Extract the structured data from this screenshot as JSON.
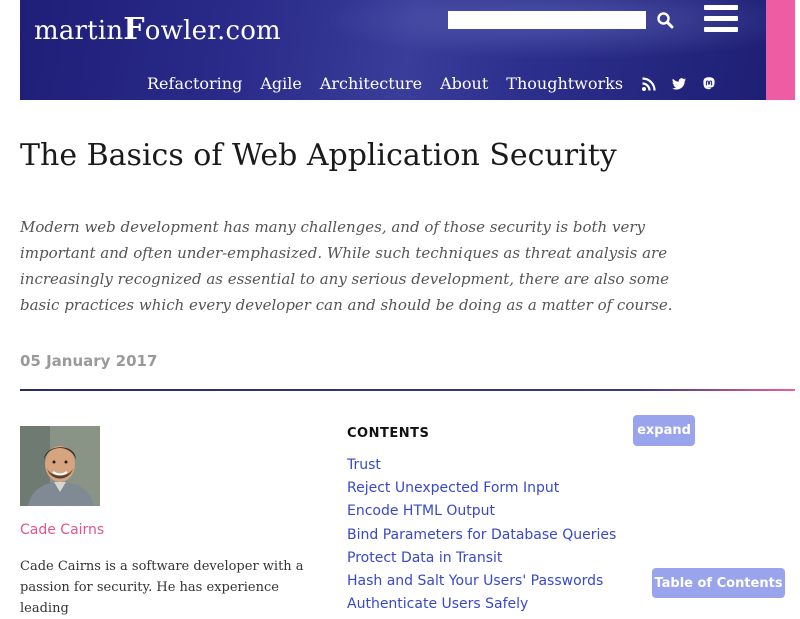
{
  "site": {
    "logo_prefix": "martin",
    "logo_initial": "F",
    "logo_suffix": "owler.com",
    "search_value": "",
    "nav": [
      "Refactoring",
      "Agile",
      "Architecture",
      "About",
      "Thoughtworks"
    ],
    "icons": [
      "search-icon",
      "menu-icon",
      "rss-icon",
      "twitter-icon",
      "mastodon-icon"
    ],
    "colors": {
      "header": "#2a2b8a",
      "accent_pink": "#ee5da3",
      "link": "#3848c8",
      "button": "#9aa4ec",
      "author": "#e2548f"
    }
  },
  "article": {
    "title": "The Basics of Web Application Security",
    "abstract": "Modern web development has many challenges, and of those security is both very important and often under-emphasized. While such techniques as threat analysis are increasingly recognized as essential to any serious development, there are also some basic practices which every developer can and should be doing as a matter of course.",
    "date": "05 January 2017"
  },
  "author": {
    "name": "Cade Cairns",
    "bio": "Cade Cairns is a software developer with a passion for security. He has experience leading"
  },
  "contents": {
    "heading": "CONTENTS",
    "items": [
      "Trust",
      "Reject Unexpected Form Input",
      "Encode HTML Output",
      "Bind Parameters for Database Queries",
      "Protect Data in Transit",
      "Hash and Salt Your Users' Passwords",
      "Authenticate Users Safely"
    ],
    "expand_label": "expand",
    "toc_button_label": "Table of Contents"
  }
}
